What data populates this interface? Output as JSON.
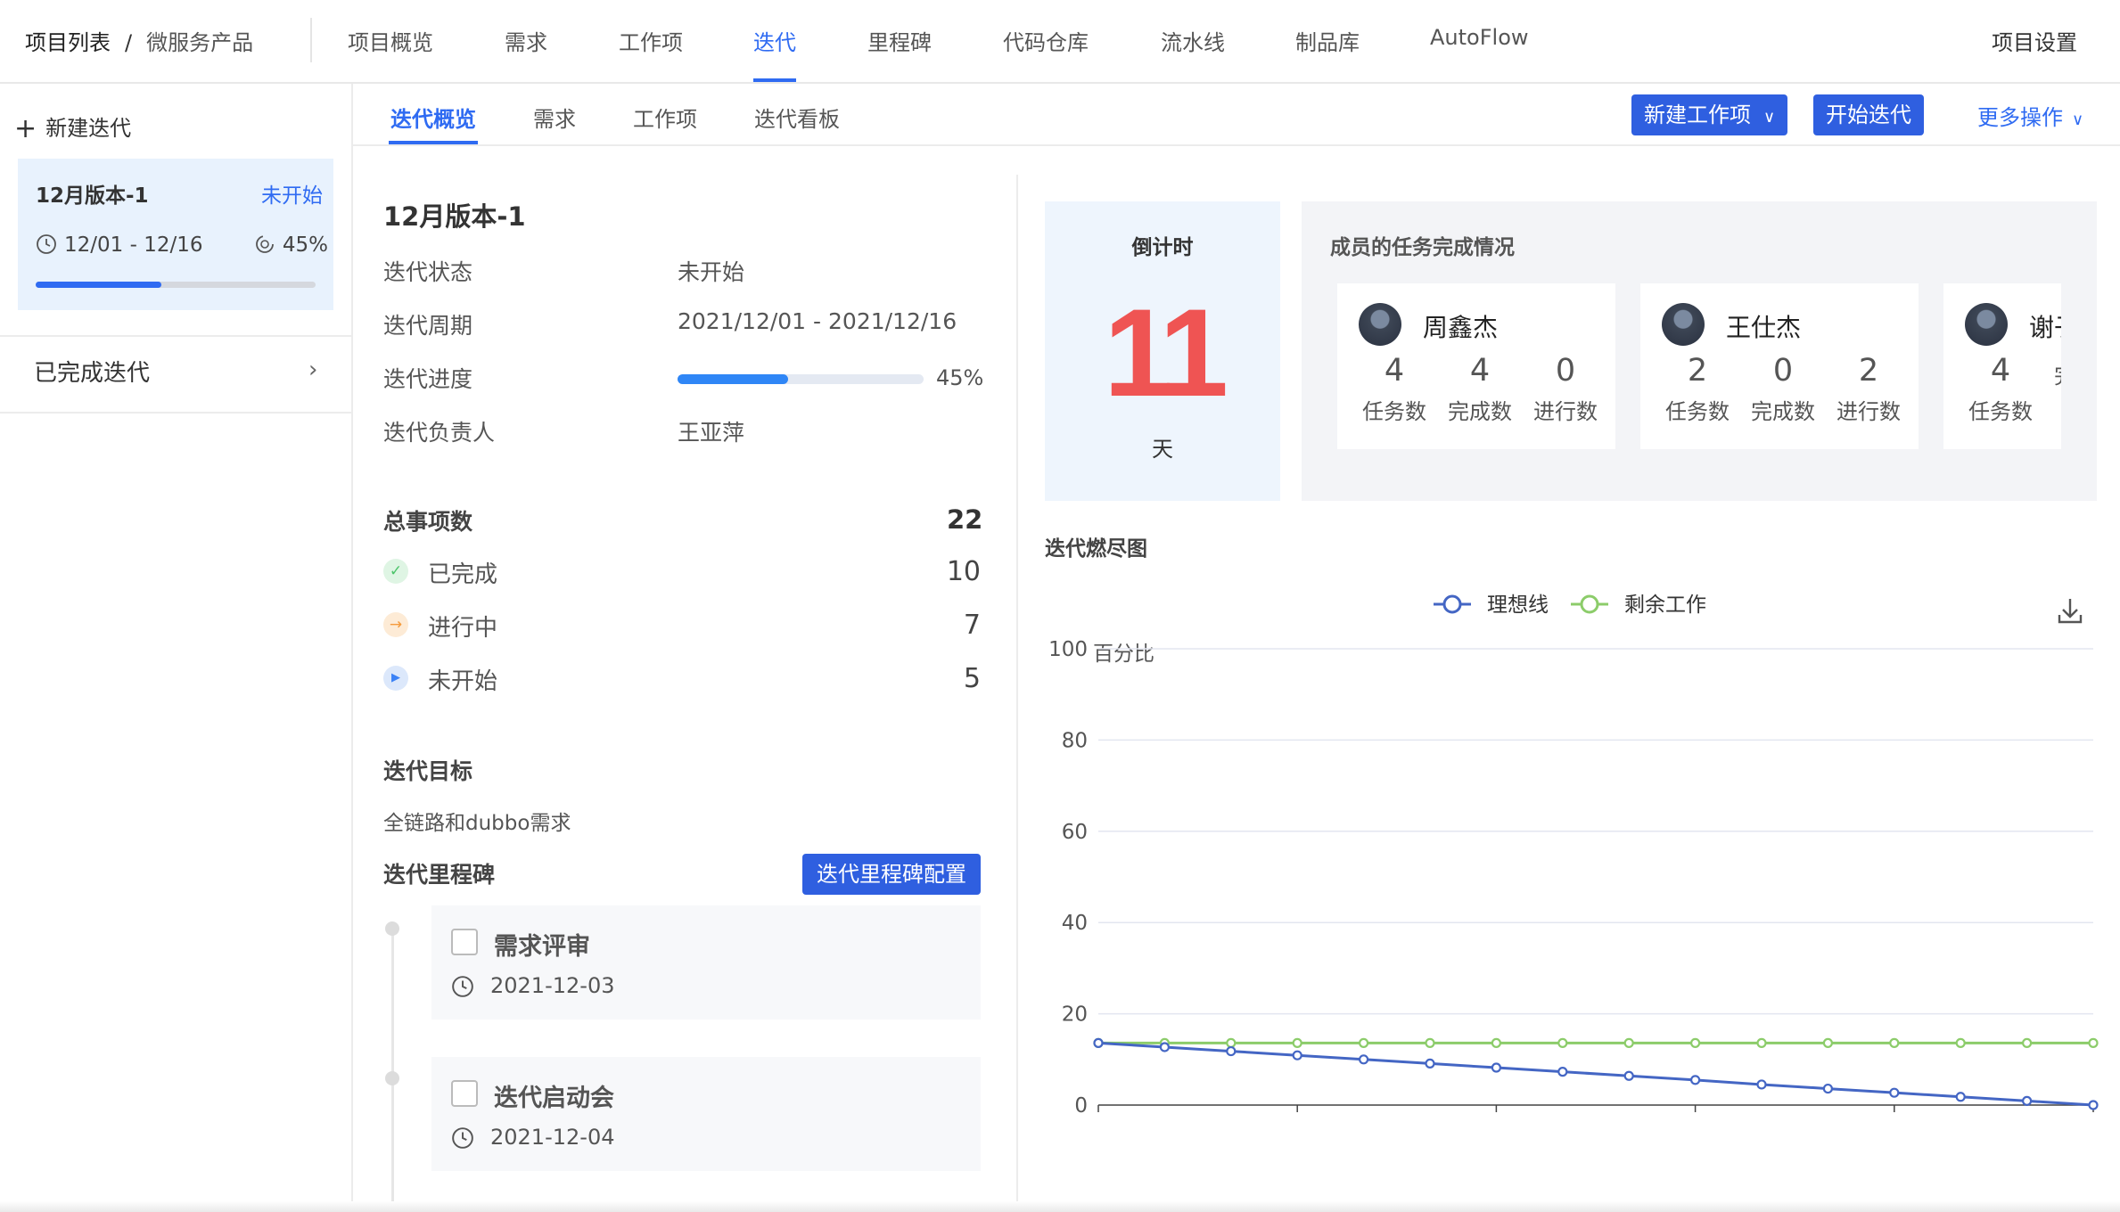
{
  "breadcrumb": {
    "root": "项目列表",
    "separator": "/",
    "project": "微服务产品"
  },
  "nav": {
    "items": [
      "项目概览",
      "需求",
      "工作项",
      "迭代",
      "里程碑",
      "代码仓库",
      "流水线",
      "制品库",
      "AutoFlow"
    ],
    "active": "迭代",
    "settings": "项目设置"
  },
  "sidebar": {
    "new_label": "新建迭代",
    "current": {
      "name": "12月版本-1",
      "status": "未开始",
      "dates": "12/01 - 12/16",
      "progress_text": "45%",
      "progress": 0.45
    },
    "completed_label": "已完成迭代"
  },
  "subtabs": {
    "items": [
      "迭代概览",
      "需求",
      "工作项",
      "迭代看板"
    ],
    "active": "迭代概览"
  },
  "actions": {
    "new_item": "新建工作项",
    "start": "开始迭代",
    "more": "更多操作"
  },
  "overview": {
    "title": "12月版本-1",
    "fields": [
      {
        "label": "迭代状态",
        "value": "未开始"
      },
      {
        "label": "迭代周期",
        "value": "2021/12/01 - 2021/12/16"
      },
      {
        "label": "迭代进度",
        "value": "45%"
      },
      {
        "label": "迭代负责人",
        "value": "王亚萍"
      }
    ],
    "progress": 0.45,
    "total_label": "总事项数",
    "total": "22",
    "stats": [
      {
        "label": "已完成",
        "value": "10",
        "icon": "check-icon",
        "color": "#4cc46a"
      },
      {
        "label": "进行中",
        "value": "7",
        "icon": "arrow-right-icon",
        "color": "#f59a3c"
      },
      {
        "label": "未开始",
        "value": "5",
        "icon": "play-icon",
        "color": "#3b82f6"
      }
    ],
    "goal_label": "迭代目标",
    "goal": "全链路和dubbo需求",
    "milestone_label": "迭代里程碑",
    "milestone_button": "迭代里程碑配置",
    "milestones": [
      {
        "name": "需求评审",
        "date": "2021-12-03"
      },
      {
        "name": "迭代启动会",
        "date": "2021-12-04"
      }
    ]
  },
  "countdown": {
    "label": "倒计时",
    "value": "11",
    "unit": "天"
  },
  "members": {
    "title": "成员的任务完成情况",
    "stat_labels": [
      "任务数",
      "完成数",
      "进行数"
    ],
    "list": [
      {
        "name": "周鑫杰",
        "stats": [
          "4",
          "4",
          "0"
        ]
      },
      {
        "name": "王仕杰",
        "stats": [
          "2",
          "0",
          "2"
        ]
      },
      {
        "name": "谢子",
        "stats": [
          "4",
          "",
          ""
        ]
      }
    ]
  },
  "burndown": {
    "title": "迭代燃尽图",
    "legend": [
      "理想线",
      "剩余工作"
    ],
    "y_label": "百分比",
    "y_ticks": [
      "100",
      "80",
      "60",
      "40",
      "20",
      "0"
    ]
  },
  "chart_data": {
    "type": "line",
    "ylabel": "百分比",
    "ylim": [
      0,
      100
    ],
    "x": [
      1,
      2,
      3,
      4,
      5,
      6,
      7,
      8,
      9,
      10,
      11,
      12,
      13,
      14,
      15,
      16
    ],
    "series": [
      {
        "name": "理想线",
        "color": "#4466c4",
        "values": [
          13.6,
          12.7,
          11.8,
          10.9,
          10.0,
          9.1,
          8.2,
          7.3,
          6.4,
          5.5,
          4.5,
          3.6,
          2.7,
          1.8,
          0.9,
          0
        ]
      },
      {
        "name": "剩余工作",
        "color": "#8ccc6a",
        "values": [
          13.6,
          13.6,
          13.6,
          13.6,
          13.6,
          13.6,
          13.6,
          13.6,
          13.6,
          13.6,
          13.6,
          13.6,
          13.6,
          13.6,
          13.6,
          13.6
        ]
      }
    ],
    "grid": true,
    "legend_position": "top-center"
  }
}
